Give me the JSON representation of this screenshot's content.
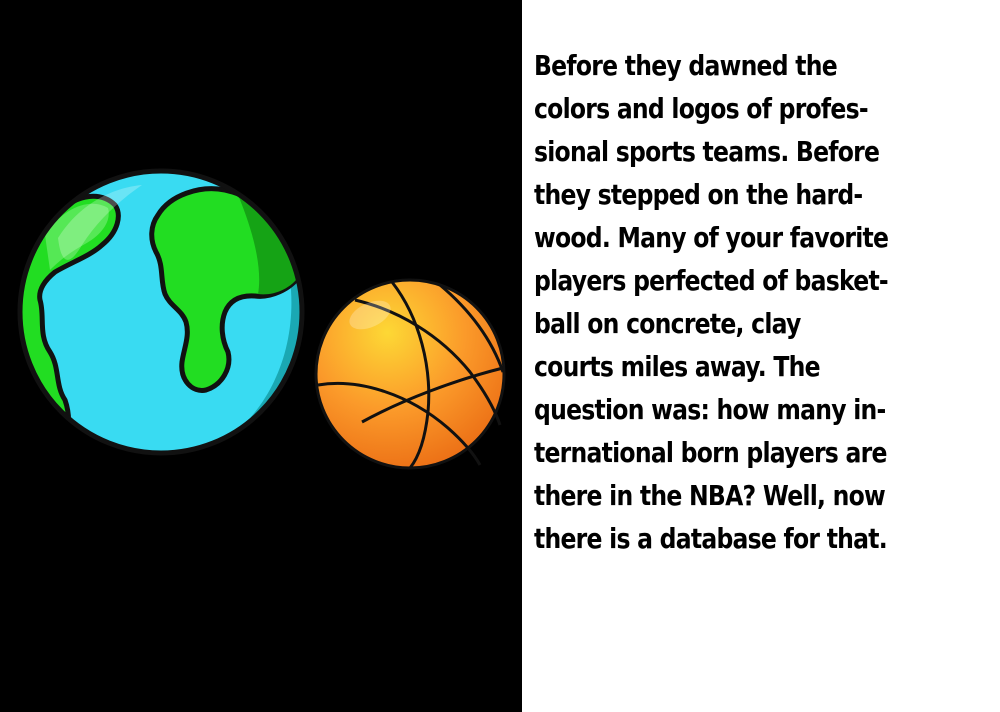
{
  "illustration": {
    "earth_icon": "earth-globe-icon",
    "ball_icon": "basketball-icon",
    "colors": {
      "background": "#000000",
      "ocean": "#39dbf2",
      "land": "#22dd22",
      "basketball": "#f7941d"
    }
  },
  "story": {
    "lines": [
      "Before they dawned the",
      "colors and logos of profes-",
      "sional sports teams. Before",
      "they stepped on the hard-",
      "wood. Many of your favorite",
      "players perfected of basket-",
      "ball on concrete, clay",
      "courts miles away. The",
      "question was: how many in-",
      "ternational born players are",
      "there in the NBA? Well, now",
      "there is a database for that."
    ]
  }
}
